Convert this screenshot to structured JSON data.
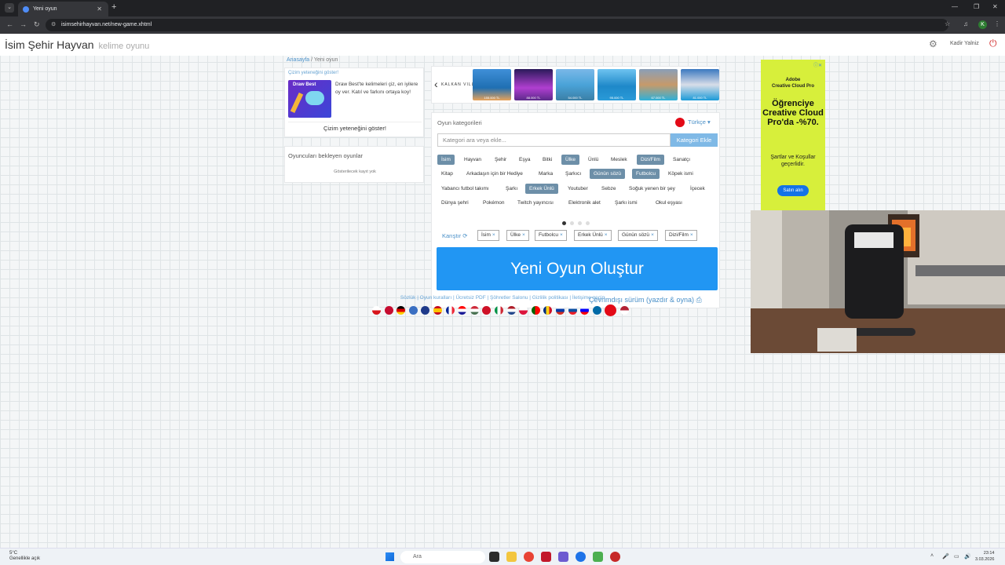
{
  "browser": {
    "tab_title": "Yeni oyun",
    "url": "isimsehirhayvan.net/new-game.xhtml",
    "profile_initial": "K"
  },
  "header": {
    "brand": "İsim Şehir Hayvan",
    "brand_sub": "kelime oyunu",
    "username": "Kadir Yalniz"
  },
  "breadcrumb": {
    "home": "Anasayfa",
    "separator": "/",
    "current": "Yeni oyun"
  },
  "draw_promo": {
    "title": "Çizim yeteneğini göster!",
    "image_label": "Draw Best",
    "description": "Draw Best'te kelimeleri çiz, en iyilere oy ver. Katıl ve farkını ortaya koy!",
    "button": "Çizim yeteneğini göster!"
  },
  "waiting": {
    "title": "Oyuncuları bekleyen oyunlar",
    "empty": "Gösterilecek kayıt yok"
  },
  "ad_strip": {
    "logo": "KALKAN VILLA",
    "prices": [
      "155.000 TL",
      "88.000 TL",
      "54.000 TL",
      "95.000 TL",
      "67.000 TL",
      "81.000 TL"
    ]
  },
  "categories": {
    "title": "Oyun kategorileri",
    "language": "Türkçe",
    "search_placeholder": "Kategori ara veya ekle...",
    "add_button": "Kategori Ekle",
    "items": [
      {
        "label": "İsim",
        "selected": true
      },
      {
        "label": "Hayvan",
        "selected": false
      },
      {
        "label": "Şehir",
        "selected": false
      },
      {
        "label": "Eşya",
        "selected": false
      },
      {
        "label": "Bitki",
        "selected": false
      },
      {
        "label": "Ülke",
        "selected": true
      },
      {
        "label": "Ünlü",
        "selected": false
      },
      {
        "label": "Meslek",
        "selected": false
      },
      {
        "label": "Dizi/Film",
        "selected": true
      },
      {
        "label": "Sanatçı",
        "selected": false
      },
      {
        "label": "Kitap",
        "selected": false
      },
      {
        "label": "Arkadaşın için bir Hediye",
        "selected": false
      },
      {
        "label": "Marka",
        "selected": false
      },
      {
        "label": "Şarkıcı",
        "selected": false
      },
      {
        "label": "Günün sözü",
        "selected": true
      },
      {
        "label": "Futbolcu",
        "selected": true
      },
      {
        "label": "Köpek ismi",
        "selected": false
      },
      {
        "label": "Yabancı futbol takımı",
        "selected": false
      },
      {
        "label": "Şarkı",
        "selected": false
      },
      {
        "label": "Erkek Ünlü",
        "selected": true
      },
      {
        "label": "Youtuber",
        "selected": false
      },
      {
        "label": "Sebze",
        "selected": false
      },
      {
        "label": "Soğuk yenen bir şey",
        "selected": false
      },
      {
        "label": "İçecek",
        "selected": false
      },
      {
        "label": "Dünya şehri",
        "selected": false
      },
      {
        "label": "Pokémon",
        "selected": false
      },
      {
        "label": "Twitch yayıncısı",
        "selected": false
      },
      {
        "label": "Elektronik alet",
        "selected": false
      },
      {
        "label": "Şarkı ismi",
        "selected": false
      },
      {
        "label": "Okul eşyası",
        "selected": false
      }
    ],
    "mix_label": "Karıştır",
    "selected": [
      "İsim",
      "Ülke",
      "Futbolcu",
      "Erkek Ünlü",
      "Günün sözü",
      "Dizi/Film"
    ],
    "create_button": "Yeni Oyun Oluştur",
    "offline_link": "Çevrimdışı sürüm (yazdır & oyna)"
  },
  "footer": {
    "links": "Sözlük | Oyun kuralları | Ücretsiz PDF | Şöhretler Salonu | Gizlilik politikası | İletişime geçin"
  },
  "side_ad": {
    "brand_line1": "Adobe",
    "brand_line2": "Creative Cloud Pro",
    "headline": "Öğrenciye Creative Cloud Pro'da -%70.",
    "subtext": "Şartlar ve Koşullar geçerlidir.",
    "button": "Satın alın"
  },
  "taskbar": {
    "temperature": "5°C",
    "weather": "Genellikle açık",
    "search_placeholder": "Ara",
    "time": "23:14",
    "date": "3.03.2026"
  },
  "colors": {
    "accent": "#2196f3",
    "chip_selected": "#6d8fa8",
    "link": "#4a90c8",
    "ad_bg": "#d7ef3b"
  }
}
